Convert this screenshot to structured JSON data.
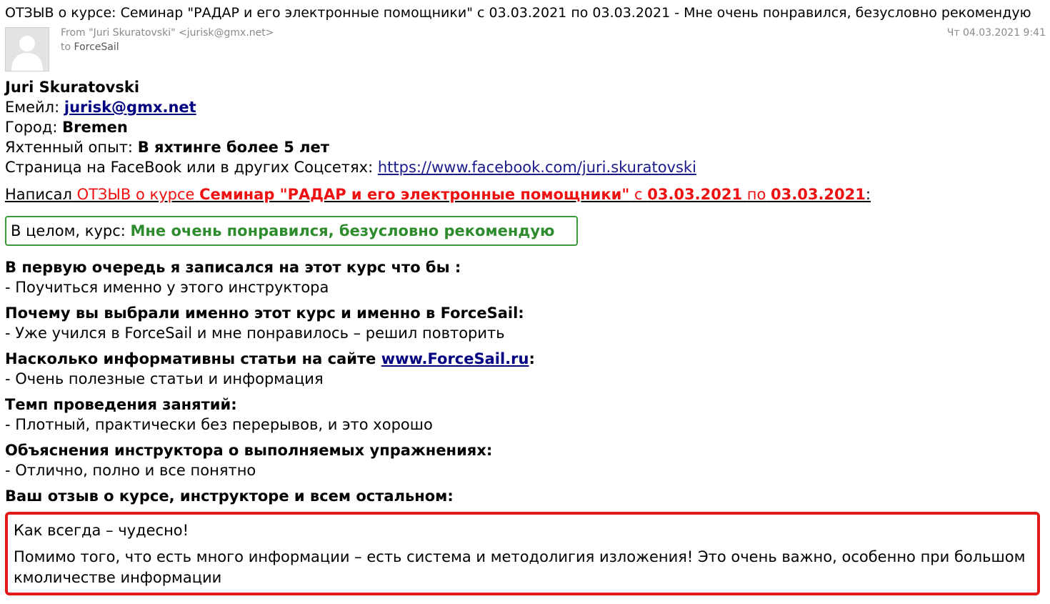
{
  "email": {
    "subject": "ОТЗЫВ о курсе: Семинар \"РАДАР и его электронные помощники\" с 03.03.2021 по 03.03.2021 - Мне очень понравился, безусловно рекомендую",
    "from_label": "From",
    "from_value": "\"Juri Skuratovski\" <jurisk@gmx.net>",
    "to_label": "to",
    "to_value": "ForceSail",
    "date": "Чт 04.03.2021 9:41",
    "avatar_icon": "person-silhouette-icon"
  },
  "profile": {
    "name": "Juri Skuratovski",
    "email_label": "Емейл:",
    "email_value": "jurisk@gmx.net",
    "city_label": "Город:",
    "city_value": "Bremen",
    "experience_label": "Яхтенный опыт:",
    "experience_value": "В яхтинге более 5 лет",
    "social_label": "Страница на FaceBook или в других Соцсетях:",
    "social_value": "https://www.facebook.com/juri.skuratovski"
  },
  "wrote": {
    "prefix": "Написал",
    "review_word": "ОТЗЫВ о курсе",
    "course": "Семинар \"РАДАР и его электронные помощники\"",
    "from_word": "с",
    "start_date": "03.03.2021",
    "to_word": "по",
    "end_date": "03.03.2021",
    "colon": ":"
  },
  "overall": {
    "label": "В целом, курс:",
    "value": "Мне очень понравился, безусловно рекомендую"
  },
  "qa": [
    {
      "q": "В первую очередь я записался на этот курс что бы :",
      "a": "- Поучиться именно у этого инструктора"
    },
    {
      "q": "Почему вы выбрали именно этот курс и именно в ForceSail:",
      "a": "- Уже учился в ForceSail и мне понравилось – решил повторить"
    },
    {
      "q_prefix": "Насколько информативны статьи на сайте",
      "q_link": "www.ForceSail.ru",
      "q_suffix": ":",
      "a": "- Очень полезные статьи и информация"
    },
    {
      "q": "Темп проведения занятий:",
      "a": "- Плотный, практически без перерывов, и это хорошо"
    },
    {
      "q": "Объяснения инструктора о выполняемых упражнениях:",
      "a": "- Отлично, полно и все понятно"
    }
  ],
  "review": {
    "heading": "Ваш отзыв о курсе, инструкторе и всем остальном:",
    "paragraphs": [
      "Как всегда – чудесно!",
      "Помимо того, что есть много информации – есть система и методолигия изложения! Это очень важно, особенно при большом кмоличестве информации"
    ]
  },
  "colors": {
    "accent_red": "#e31a1a",
    "accent_green": "#2e8b2e",
    "link_blue": "#000080"
  }
}
